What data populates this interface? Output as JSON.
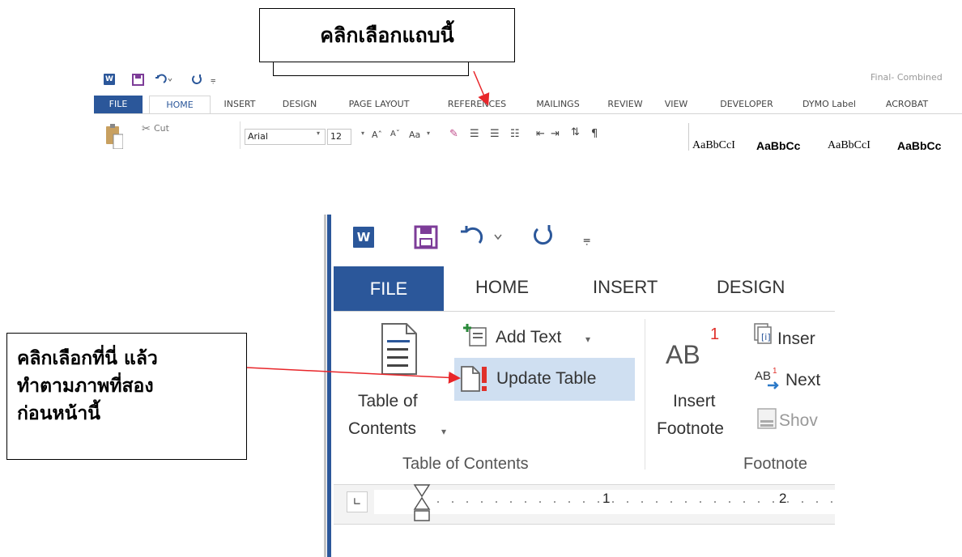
{
  "callouts": {
    "top": "คลิกเลือกแถบนี้",
    "left": [
      "คลิกเลือกที่นี่ แล้ว",
      "ทำตามภาพที่สอง",
      "ก่อนหน้านี้"
    ]
  },
  "small_window": {
    "doc_title": "Final- Combined",
    "tabs": [
      "FILE",
      "HOME",
      "INSERT",
      "DESIGN",
      "PAGE LAYOUT",
      "REFERENCES",
      "MAILINGS",
      "REVIEW",
      "VIEW",
      "DEVELOPER",
      "DYMO Label",
      "ACROBAT"
    ],
    "clipboard_cut": "Cut",
    "font_name": "Arial",
    "font_size": "12",
    "change_case": "Aa",
    "styles": [
      "AaBbCcI",
      "AaBbCc",
      "AaBbCcI",
      "AaBbCc"
    ]
  },
  "zoomed_window": {
    "tabs": [
      "FILE",
      "HOME",
      "INSERT",
      "DESIGN"
    ],
    "toc_button": [
      "Table of",
      "Contents"
    ],
    "add_text": "Add Text",
    "update_table": "Update Table",
    "insert_footnote_icon": "AB",
    "insert_footnote": [
      "Insert",
      "Footnote"
    ],
    "insert_endnote": "Inser",
    "next_footnote": "Next",
    "show_notes": "Shov",
    "group_toc": "Table of Contents",
    "group_footnotes": "Footnote",
    "ruler_numbers": [
      "1",
      "2"
    ]
  },
  "colors": {
    "accent": "#2b579a",
    "arrow": "#e8262a",
    "highlight": "#cfdff1"
  }
}
